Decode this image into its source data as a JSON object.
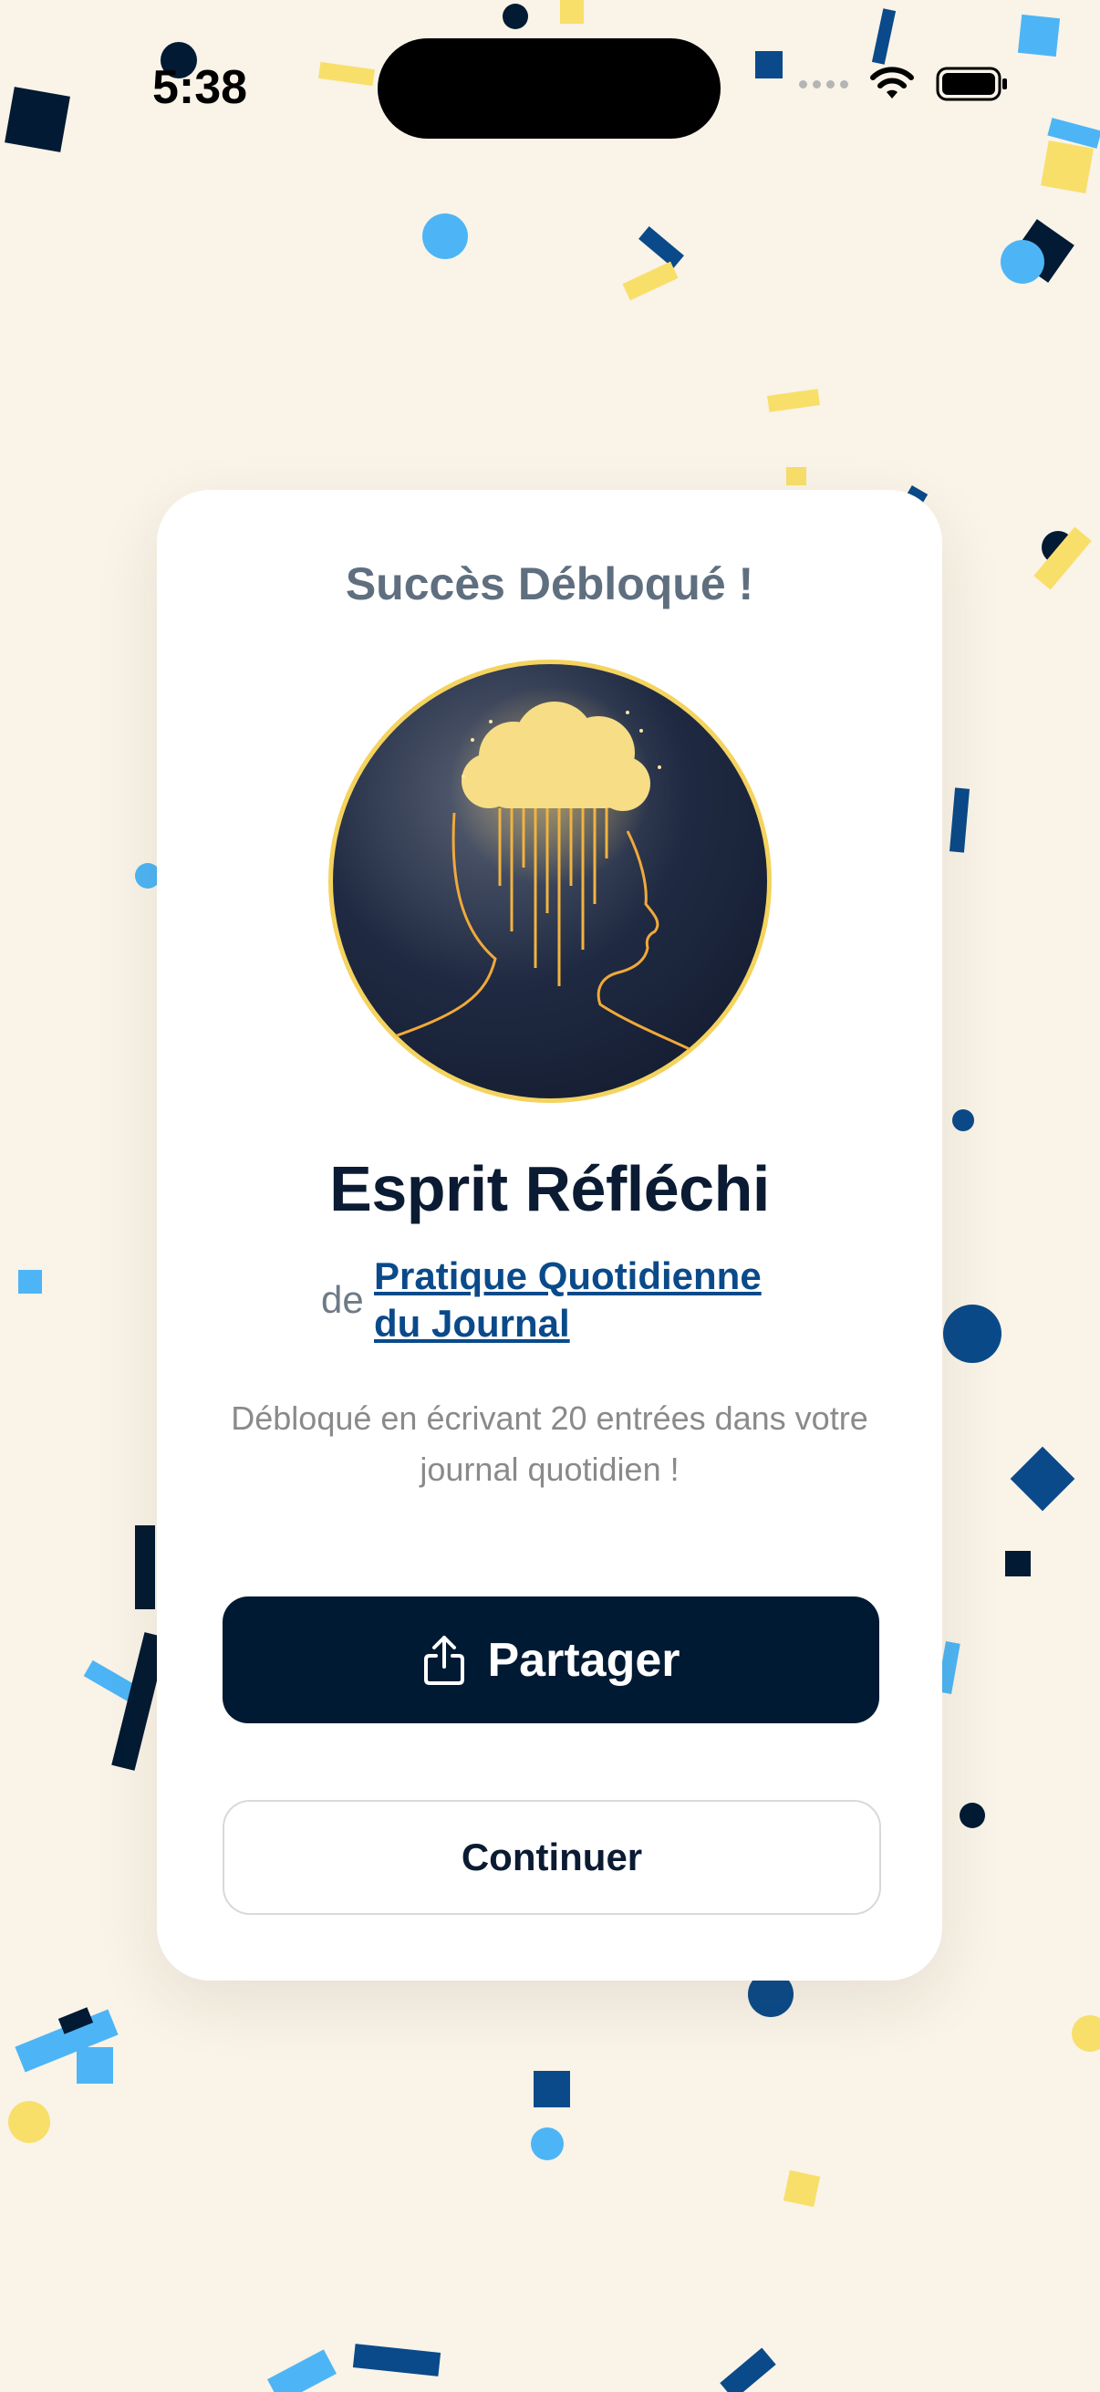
{
  "status_bar": {
    "time": "5:38"
  },
  "card": {
    "title": "Succès Débloqué !",
    "achievement_name": "Esprit Réfléchi",
    "source_prefix": "de",
    "source_link": "Pratique Quotidienne du Journal",
    "description": "Débloqué en écrivant 20 entrées dans votre journal quotidien !",
    "share_label": "Partager",
    "continue_label": "Continuer"
  },
  "colors": {
    "background": "#f9f3e8",
    "primary_navy": "#011a33",
    "link_blue": "#0a4a8a",
    "gold": "#f4d35e",
    "confetti": [
      "#021a33",
      "#0a4a8a",
      "#4db5f5",
      "#f8df6a"
    ]
  },
  "icons": [
    "wifi-icon",
    "battery-icon",
    "signal-icon",
    "share-icon",
    "head-cloud-badge-icon"
  ]
}
